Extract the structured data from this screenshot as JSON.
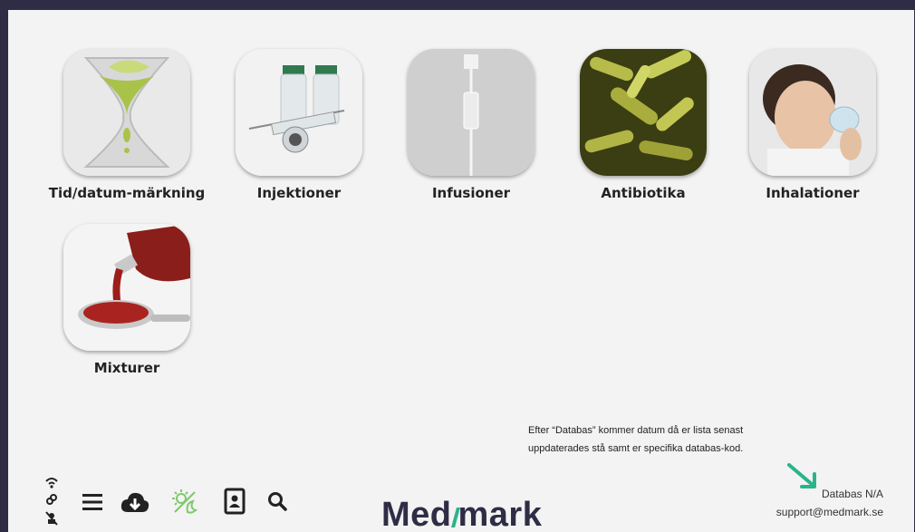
{
  "tiles": [
    {
      "label": "Tid/datum-märkning",
      "icon": "hourglass-icon"
    },
    {
      "label": "Injektioner",
      "icon": "syringe-vial-icon"
    },
    {
      "label": "Infusioner",
      "icon": "iv-drip-icon"
    },
    {
      "label": "Antibiotika",
      "icon": "bacteria-icon"
    },
    {
      "label": "Inhalationer",
      "icon": "child-inhaler-icon"
    },
    {
      "label": "Mixturer",
      "icon": "spoon-syrup-icon"
    }
  ],
  "toolbar": {
    "icons": [
      "connection-status-icon",
      "menu-icon",
      "cloud-download-icon",
      "theme-toggle-icon",
      "contact-card-icon",
      "search-icon"
    ]
  },
  "note": {
    "line1": "Efter “Databas” kommer datum då er lista senast",
    "line2": "uppdaterades stå samt er specifika databas-kod."
  },
  "footer": {
    "database": "Databas N/A",
    "support_email": "support@medmark.se",
    "logo_prefix": "Med",
    "logo_suffix": "mark",
    "brand_color": "#2e2d45",
    "accent_color": "#2bb38a"
  }
}
